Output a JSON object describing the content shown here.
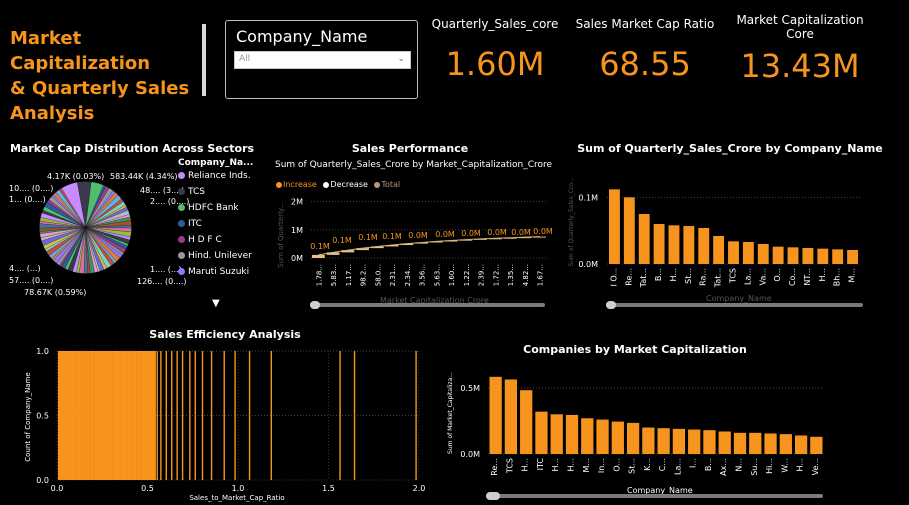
{
  "dashboard": {
    "title_lines": [
      "Market Capitalization",
      "& Quarterly Sales",
      "Analysis"
    ]
  },
  "slicer": {
    "title": "Company_Name",
    "value": "All"
  },
  "kpis": [
    {
      "title": "Quarterly_Sales_core",
      "value": "1.60M"
    },
    {
      "title": "Sales Market Cap Ratio",
      "value": "68.55"
    },
    {
      "title": "Market Capitalization Core",
      "value": "13.43M"
    }
  ],
  "pie": {
    "title": "Market Cap Distribution Across Sectors",
    "legend_title": "Company_Na...",
    "legend": [
      {
        "label": "Reliance Inds.",
        "color": "#c58bff"
      },
      {
        "label": "TCS",
        "color": "#3a3a4a"
      },
      {
        "label": "HDFC Bank",
        "color": "#4fbf6f"
      },
      {
        "label": "ITC",
        "color": "#2f5b9a"
      },
      {
        "label": "H D F C",
        "color": "#9b3c8a"
      },
      {
        "label": "Hind. Unilever",
        "color": "#9a9a9a"
      },
      {
        "label": "Maruti Suzuki",
        "color": "#8a7cff"
      }
    ],
    "labels_left": [
      "4.17K (0.03%)",
      "10.... (0....)",
      "1... (0....)",
      "4.... (...)",
      "57.... (0....)",
      "78.67K (0.59%)"
    ],
    "labels_right": [
      "583.44K (4.34%)",
      "48.... (3....)",
      "2.... (0....)",
      "1.... (...)",
      "126.... (0....)"
    ]
  },
  "waterfall": {
    "title": "Sales Performance",
    "subtitle": "Sum of Quarterly_Sales_Crore by Market_Capitalization_Crore",
    "legend": [
      {
        "label": "Increase",
        "color": "#f7941d"
      },
      {
        "label": "Decrease",
        "color": "#ffffff"
      },
      {
        "label": "Total",
        "color": "#b59a78"
      }
    ],
    "xlabel": "Market Capitalization Crore",
    "ylabel": "Sum of Quarterly...",
    "y_ticks": [
      "2M",
      "1M",
      "0M"
    ],
    "x_ticks": [
      "1.78...",
      "5.83...",
      "1.17...",
      "98.2...",
      "58.0...",
      "2.31...",
      "2.34...",
      "3.56...",
      "5.63...",
      "1.60...",
      "1.22...",
      "2.39...",
      "1.72...",
      "1.35...",
      "4.82...",
      "1.67..."
    ],
    "data_labels": [
      "0.1M",
      "0.1M",
      "0.1M",
      "0.1M",
      "0.0M",
      "0.0M",
      "0.0M",
      "0.0M",
      "0.0M",
      "0.0M"
    ]
  },
  "bar_sales": {
    "title": "Sum of Quarterly_Sales_Crore by Company_Name",
    "xlabel": "Company_Name",
    "ylabel": "Sum of Quarterly_Sales_Cro...",
    "y_ticks": [
      "0.1M",
      "0.0M"
    ]
  },
  "efficiency": {
    "title": "Sales Efficiency Analysis",
    "xlabel": "Sales_to_Market_Cap_Ratio",
    "ylabel": "Count of Company_Name",
    "y_ticks": [
      "1.0",
      "0.5",
      "0.0"
    ],
    "x_ticks": [
      "0.0",
      "0.5",
      "1.0",
      "1.5",
      "2.0"
    ]
  },
  "bar_mcap": {
    "title": "Companies by Market Capitalization",
    "xlabel": "Company_Name",
    "ylabel": "Sum of Market_Capitaliza...",
    "y_ticks": [
      "0.5M",
      "0.0M"
    ]
  },
  "chart_data": [
    {
      "type": "bar",
      "title": "Sum of Quarterly_Sales_Crore by Company_Name",
      "xlabel": "Company_Name",
      "categories": [
        "I O...",
        "Re...",
        "Tat...",
        "B...",
        "H...",
        "St...",
        "Ra...",
        "Tat...",
        "TCS",
        "La...",
        "Va...",
        "O...",
        "Co...",
        "NT...",
        "H...",
        "Bh...",
        "M..."
      ],
      "values": [
        0.112,
        0.1,
        0.075,
        0.06,
        0.058,
        0.057,
        0.054,
        0.042,
        0.034,
        0.033,
        0.03,
        0.026,
        0.025,
        0.024,
        0.023,
        0.022,
        0.021
      ],
      "ylim": [
        0,
        0.135
      ],
      "units": "M"
    },
    {
      "type": "bar",
      "title": "Companies by Market Capitalization",
      "xlabel": "Company_Name",
      "categories": [
        "Re...",
        "TCS",
        "H...",
        "ITC",
        "H...",
        "H...",
        "M...",
        "In...",
        "O...",
        "St...",
        "K...",
        "C...",
        "La...",
        "I...",
        "B...",
        "Ax...",
        "N...",
        "Su...",
        "Hi...",
        "W...",
        "H...",
        "Ve..."
      ],
      "values": [
        0.583,
        0.563,
        0.482,
        0.32,
        0.3,
        0.295,
        0.27,
        0.26,
        0.245,
        0.235,
        0.2,
        0.195,
        0.19,
        0.185,
        0.18,
        0.17,
        0.16,
        0.16,
        0.155,
        0.15,
        0.14,
        0.13
      ],
      "ylim": [
        0,
        0.68
      ],
      "units": "M"
    },
    {
      "type": "bar",
      "title": "Sales Efficiency Analysis",
      "xlabel": "Sales_to_Market_Cap_Ratio",
      "x": [
        0.02,
        0.04,
        0.05,
        0.07,
        0.09,
        0.11,
        0.12,
        0.14,
        0.16,
        0.18,
        0.19,
        0.21,
        0.23,
        0.25,
        0.26,
        0.28,
        0.29,
        0.31,
        0.33,
        0.35,
        0.36,
        0.38,
        0.4,
        0.42,
        0.43,
        0.45,
        0.47,
        0.49,
        0.5,
        0.52,
        0.55,
        0.57,
        0.6,
        0.63,
        0.66,
        0.69,
        0.73,
        0.76,
        0.8,
        0.85,
        0.92,
        0.98,
        1.06,
        1.18,
        1.56,
        1.64,
        1.98
      ],
      "values": [
        1,
        1,
        1,
        1,
        1,
        1,
        1,
        1,
        1,
        1,
        1,
        1,
        1,
        1,
        1,
        1,
        1,
        1,
        1,
        1,
        1,
        1,
        1,
        1,
        1,
        1,
        1,
        1,
        1,
        1,
        1,
        1,
        1,
        1,
        1,
        1,
        1,
        1,
        1,
        1,
        1,
        1,
        1,
        1,
        1,
        1,
        1
      ],
      "xlim": [
        0,
        2
      ],
      "ylim": [
        0,
        1
      ]
    },
    {
      "type": "bar",
      "title": "Sales Performance",
      "subtitle": "Sum of Quarterly_Sales_Crore by Market_Capitalization_Crore",
      "categories": [
        "1.78...",
        "5.83...",
        "1.17...",
        "98.2...",
        "58.0...",
        "2.31...",
        "2.34...",
        "3.56...",
        "5.63...",
        "1.60...",
        "1.22...",
        "2.39...",
        "1.72...",
        "1.35...",
        "4.82...",
        "1.67..."
      ],
      "cumulative": [
        0.11,
        0.2,
        0.28,
        0.35,
        0.41,
        0.46,
        0.51,
        0.55,
        0.59,
        0.62,
        0.65,
        0.68,
        0.7,
        0.72,
        0.74,
        0.76
      ],
      "ylim": [
        0,
        2.2
      ],
      "units": "M"
    }
  ]
}
